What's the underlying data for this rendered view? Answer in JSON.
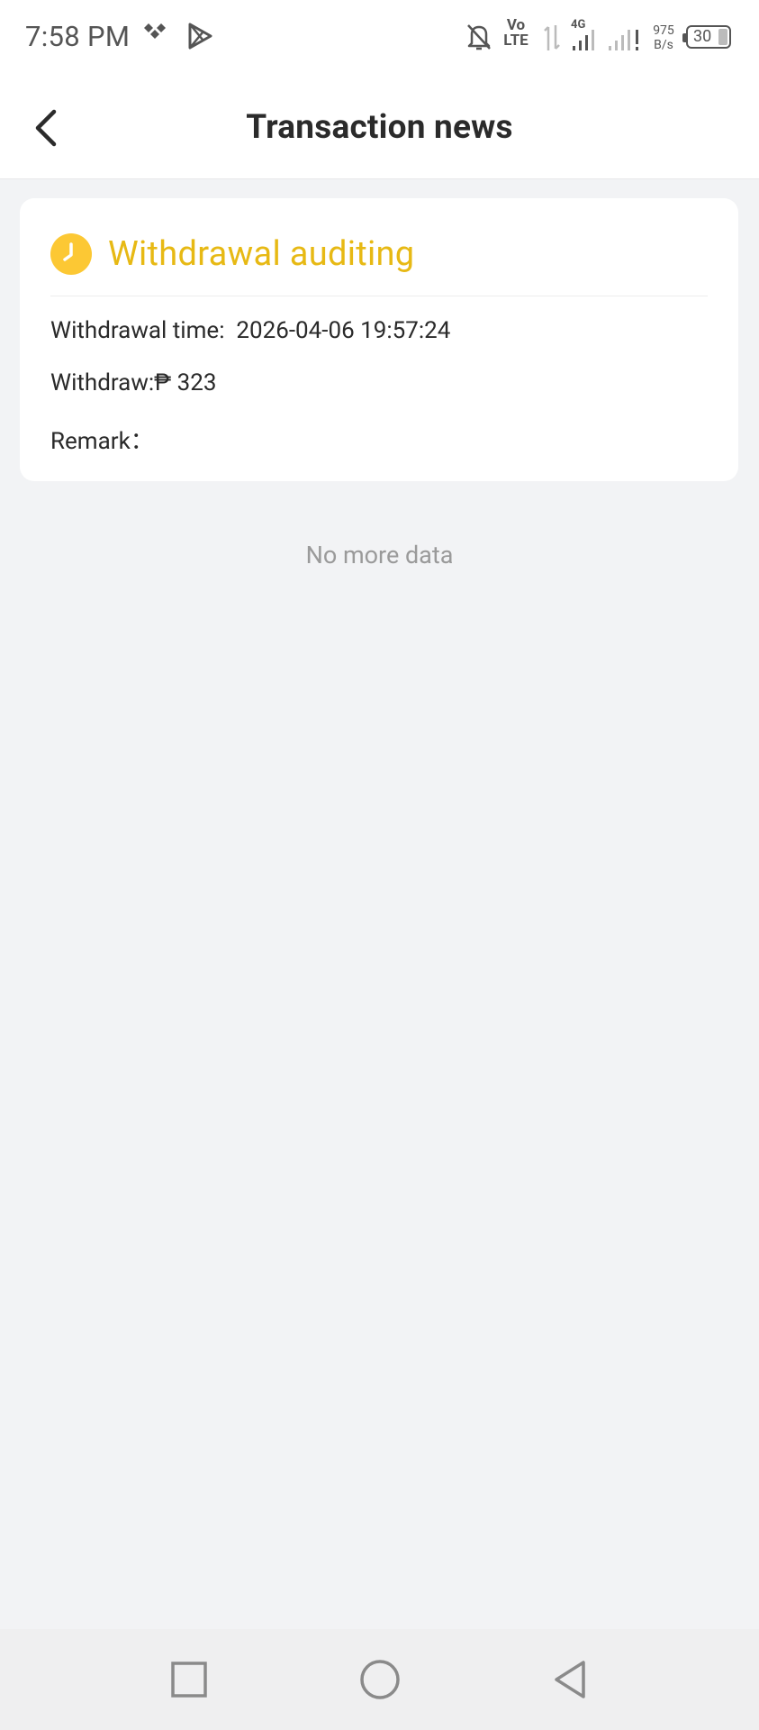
{
  "status_bar": {
    "time": "7:58 PM",
    "net_speed_value": "975",
    "net_speed_unit": "B/s",
    "battery": "30",
    "network_type": "4G",
    "volte_top": "Vo",
    "volte_bottom": "LTE"
  },
  "header": {
    "title": "Transaction news"
  },
  "transaction": {
    "status": "Withdrawal auditing",
    "status_color": "#e7b914",
    "time_label": "Withdrawal time:",
    "time_value": "2026-04-06 19:57:24",
    "amount_label": "Withdraw:",
    "currency_symbol": "₱",
    "amount_value": "323",
    "remark_label": "Remark：",
    "remark_value": ""
  },
  "list_footer": "No more data",
  "colors": {
    "accent": "#e7b914",
    "background": "#f2f3f5",
    "card": "#ffffff"
  },
  "icons": {
    "back": "chevron-left-icon",
    "status": "clock-icon",
    "nav_recent": "square-icon",
    "nav_home": "circle-icon",
    "nav_back": "triangle-back-icon"
  }
}
